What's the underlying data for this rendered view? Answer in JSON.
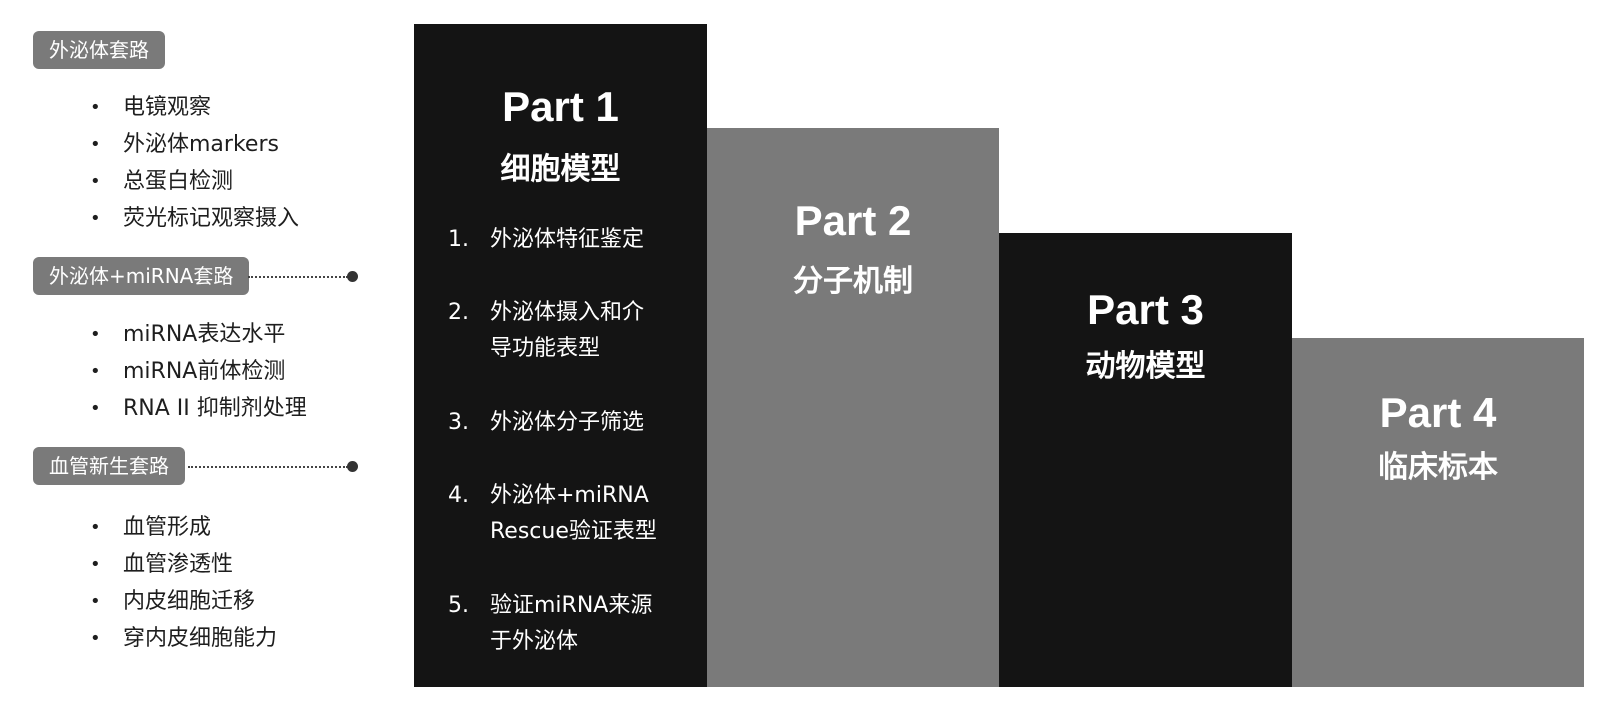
{
  "left": {
    "sections": [
      {
        "tag": "外泌体套路",
        "items": [
          "电镜观察",
          "外泌体markers",
          "总蛋白检测",
          "荧光标记观察摄入"
        ]
      },
      {
        "tag": "外泌体+miRNA套路",
        "items": [
          "miRNA表达水平",
          "miRNA前体检测",
          "RNA II 抑制剂处理"
        ]
      },
      {
        "tag": "血管新生套路",
        "items": [
          "血管形成",
          "血管渗透性",
          "内皮细胞迁移",
          "穿内皮细胞能力"
        ]
      }
    ]
  },
  "parts": [
    {
      "title": "Part 1",
      "subtitle": "细胞模型",
      "steps": [
        {
          "num": "1.",
          "line1": "外泌体特征鉴定",
          "line2": ""
        },
        {
          "num": "2.",
          "line1": "外泌体摄入和介",
          "line2": "导功能表型"
        },
        {
          "num": "3.",
          "line1": "外泌体分子筛选",
          "line2": ""
        },
        {
          "num": "4.",
          "line1": "外泌体+miRNA",
          "line2": "Rescue验证表型"
        },
        {
          "num": "5.",
          "line1": "验证miRNA来源",
          "line2": "于外泌体"
        }
      ]
    },
    {
      "title": "Part 2",
      "subtitle": "分子机制"
    },
    {
      "title": "Part 3",
      "subtitle": "动物模型"
    },
    {
      "title": "Part 4",
      "subtitle": "临床标本"
    }
  ],
  "colors": {
    "dark_panel": "#141414",
    "gray_panel": "#7a7a7a",
    "tag_bg": "#7a7a7a"
  }
}
